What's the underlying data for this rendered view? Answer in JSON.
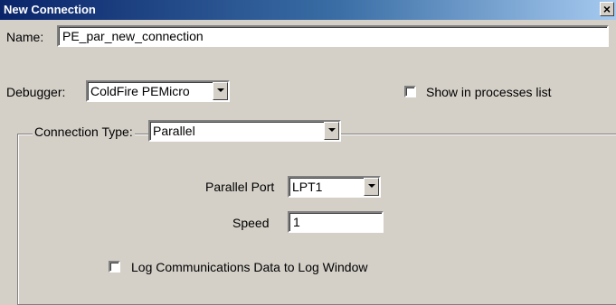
{
  "window": {
    "title": "New Connection",
    "close_glyph": "×",
    "close_icon": "close-icon"
  },
  "name": {
    "label": "Name:",
    "value": "PE_par_new_connection"
  },
  "debugger": {
    "label": "Debugger:",
    "selected": "ColdFire PEMicro"
  },
  "show_in_processes": {
    "label": "Show in processes list",
    "checked": false
  },
  "connection_type": {
    "label": "Connection Type:",
    "selected": "Parallel"
  },
  "parallel_port": {
    "label": "Parallel Port",
    "selected": "LPT1"
  },
  "speed": {
    "label": "Speed",
    "value": "1"
  },
  "log_comm": {
    "label": "Log Communications Data to Log Window",
    "checked": false
  }
}
